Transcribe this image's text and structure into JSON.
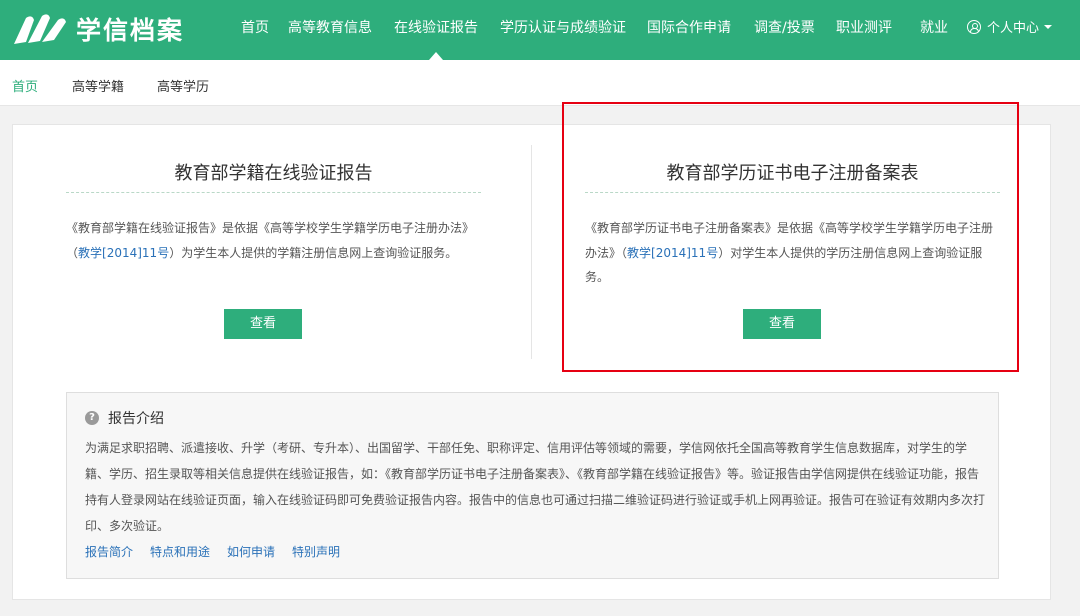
{
  "colors": {
    "brand": "#2eae7c",
    "link": "#2a71b8",
    "highlight_box": "#e60012"
  },
  "header": {
    "logo_text": "学信档案",
    "nav": [
      {
        "label": "首页"
      },
      {
        "label": "高等教育信息"
      },
      {
        "label": "在线验证报告",
        "active": true
      },
      {
        "label": "学历认证与成绩验证"
      },
      {
        "label": "国际合作申请"
      },
      {
        "label": "调查/投票"
      },
      {
        "label": "职业测评"
      },
      {
        "label": "就业"
      }
    ],
    "user_menu": "个人中心",
    "user_icon": "user-circle-icon"
  },
  "subnav": [
    {
      "label": "首页"
    },
    {
      "label": "高等学籍"
    },
    {
      "label": "高等学历"
    }
  ],
  "cards": [
    {
      "title": "教育部学籍在线验证报告",
      "desc_before": "《教育部学籍在线验证报告》是依据《高等学校学生学籍学历电子注册办法》（",
      "desc_link": "教学[2014]11号",
      "desc_after": "）为学生本人提供的学籍注册信息网上查询验证服务。",
      "button": "查看"
    },
    {
      "title": "教育部学历证书电子注册备案表",
      "desc_before": "《教育部学历证书电子注册备案表》是依据《高等学校学生学籍学历电子注册办法》（",
      "desc_link": "教学[2014]11号",
      "desc_after": "）对学生本人提供的学历注册信息网上查询验证服务。",
      "button": "查看"
    }
  ],
  "intro": {
    "icon": "question-circle-icon",
    "title": "报告介绍",
    "text": "为满足求职招聘、派遣接收、升学（考研、专升本）、出国留学、干部任免、职称评定、信用评估等领域的需要，学信网依托全国高等教育学生信息数据库，对学生的学籍、学历、招生录取等相关信息提供在线验证报告，如：《教育部学历证书电子注册备案表》、《教育部学籍在线验证报告》等。验证报告由学信网提供在线验证功能，报告持有人登录网站在线验证页面，输入在线验证码即可免费验证报告内容。报告中的信息也可通过扫描二维验证码进行验证或手机上网再验证。报告可在验证有效期内多次打印、多次验证。",
    "links": [
      {
        "label": "报告简介"
      },
      {
        "label": "特点和用途"
      },
      {
        "label": "如何申请"
      },
      {
        "label": "特别声明"
      }
    ]
  }
}
